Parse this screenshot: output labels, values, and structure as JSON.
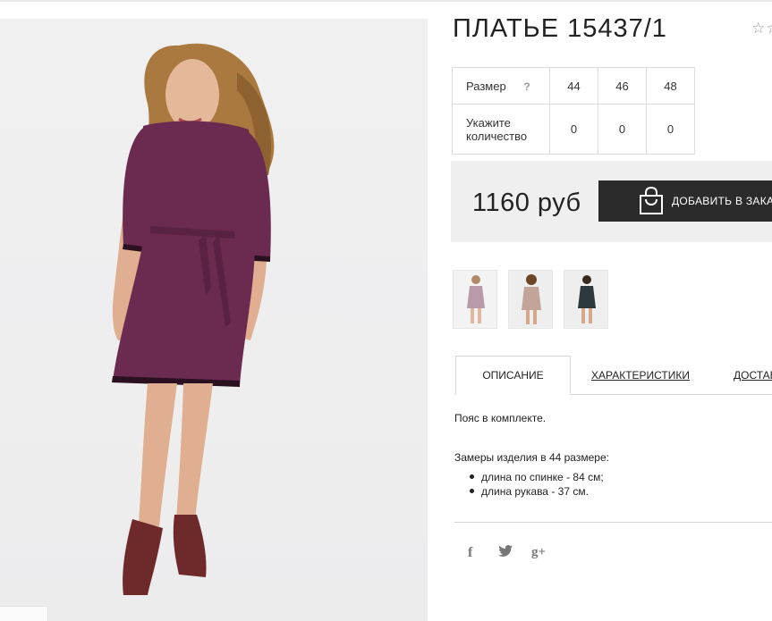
{
  "product": {
    "title": "ПЛАТЬЕ 15437/1",
    "rating": "☆☆"
  },
  "size_table": {
    "size_label": "Размер",
    "help": "?",
    "sizes": [
      "44",
      "46",
      "48"
    ],
    "qty_label": "Укажите количество",
    "quantities": [
      "0",
      "0",
      "0"
    ]
  },
  "purchase": {
    "price": "1160 руб",
    "add_button": "ДОБАВИТЬ В ЗАКАЗ"
  },
  "tabs": [
    {
      "label": "ОПИСАНИЕ",
      "active": true
    },
    {
      "label": "ХАРАКТЕРИСТИКИ",
      "active": false
    },
    {
      "label": "ДОСТАВКА",
      "active": false
    }
  ],
  "description": {
    "line1": "Пояс в комплекте.",
    "line2": "Замеры изделия в 44 размере:",
    "items": [
      "длина по спинке - 84 см;",
      "длина рукава - 37 см."
    ]
  },
  "social": {
    "facebook": "f",
    "twitter": "🐦",
    "google": "g+"
  },
  "colors": {
    "dress": "#6b2a4f",
    "button": "#2b2b2b",
    "price_bg": "#efefef"
  }
}
